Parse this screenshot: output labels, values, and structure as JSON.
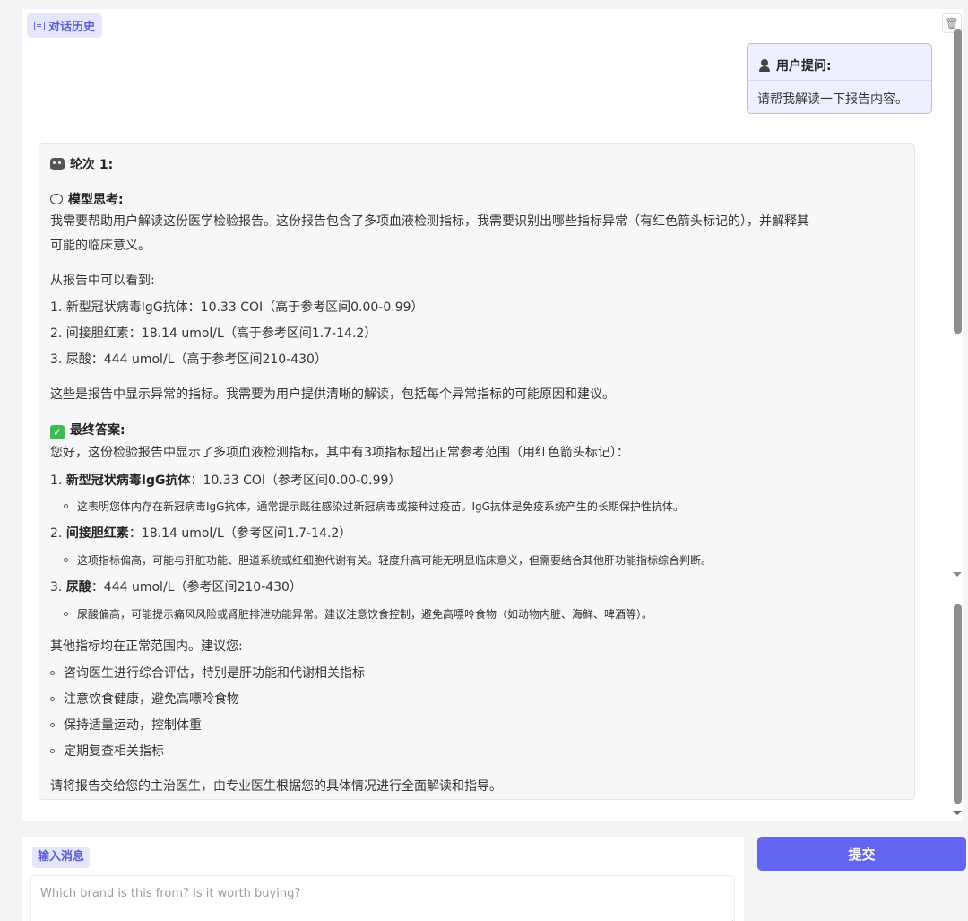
{
  "history": {
    "label": "对话历史",
    "trash_icon": "trash-icon"
  },
  "user_message": {
    "title": "用户提问:",
    "text": "请帮我解读一下报告内容。"
  },
  "answer": {
    "round_label": "轮次 1:",
    "thinking_label": "模型思考:",
    "thinking_lines": [
      "我需要帮助用户解读这份医学检验报告。这份报告包含了多项血液检测指标，我需要识别出哪些指标异常（有红色箭头标记的），并解释其",
      "可能的临床意义。",
      "从报告中可以看到:",
      "1. 新型冠状病毒IgG抗体：10.33 COI（高于参考区间0.00-0.99）",
      "2. 间接胆红素：18.14 umol/L（高于参考区间1.7-14.2）",
      "3. 尿酸：444 umol/L（高于参考区间210-430）",
      "这些是报告中显示异常的指标。我需要为用户提供清晰的解读，包括每个异常指标的可能原因和建议。"
    ],
    "final_label": "最终答案:",
    "final_intro": "您好，这份检验报告中显示了多项血液检测指标，其中有3项指标超出正常参考范围（用红色箭头标记）：",
    "items": [
      {
        "num": "1.",
        "name": "新型冠状病毒IgG抗体",
        "value": "：10.33 COI（参考区间0.00-0.99）",
        "note": "这表明您体内存在新冠病毒IgG抗体，通常提示既往感染过新冠病毒或接种过疫苗。IgG抗体是免疫系统产生的长期保护性抗体。"
      },
      {
        "num": "2.",
        "name": "间接胆红素",
        "value": "：18.14 umol/L（参考区间1.7-14.2）",
        "note": "这项指标偏高，可能与肝脏功能、胆道系统或红细胞代谢有关。轻度升高可能无明显临床意义，但需要结合其他肝功能指标综合判断。"
      },
      {
        "num": "3.",
        "name": "尿酸",
        "value": "：444 umol/L（参考区间210-430）",
        "note": "尿酸偏高，可能提示痛风风险或肾脏排泄功能异常。建议注意饮食控制，避免高嘌呤食物（如动物内脏、海鲜、啤酒等）。"
      }
    ],
    "advice_intro": "其他指标均在正常范围内。建议您:",
    "advice": [
      "咨询医生进行综合评估，特别是肝功能和代谢相关指标",
      "注意饮食健康，避免高嘌呤食物",
      "保持适量运动，控制体重",
      "定期复查相关指标"
    ],
    "closing": "请将报告交给您的主治医生，由专业医生根据您的具体情况进行全面解读和指导。"
  },
  "input": {
    "label": "输入消息",
    "placeholder": "Which brand is this from? Is it worth buying?"
  },
  "submit_label": "提交"
}
